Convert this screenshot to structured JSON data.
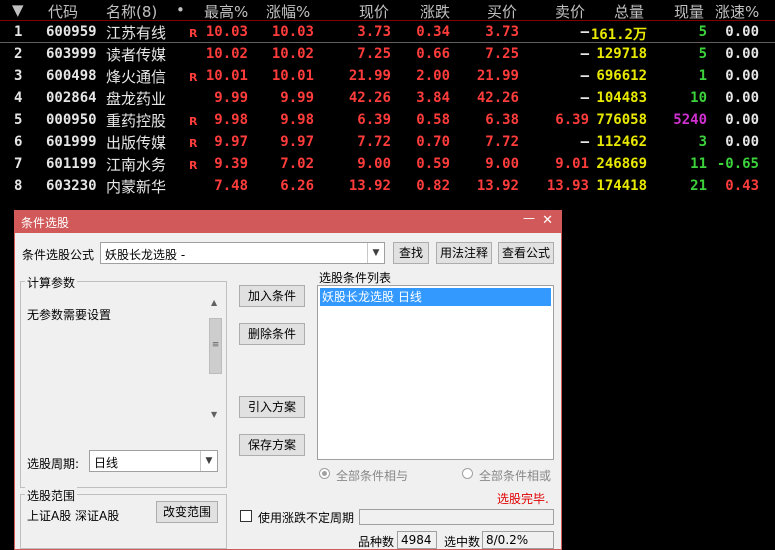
{
  "table": {
    "sort_icon": "sort-down-icon",
    "headers": [
      "代码",
      "名称(8)",
      "•",
      "最高%",
      "涨幅%",
      "现价",
      "涨跌",
      "买价",
      "卖价",
      "总量",
      "现量",
      "涨速%"
    ],
    "rows": [
      {
        "idx": "1",
        "code": "600959",
        "name": "江苏有线",
        "mark": "R",
        "high": "10.03",
        "chg_pct": "10.03",
        "price": "3.73",
        "change": "0.34",
        "bid": "3.73",
        "ask": "—",
        "volume": "161.2万",
        "cur_vol": "5",
        "speed": "0.00"
      },
      {
        "idx": "2",
        "code": "603999",
        "name": "读者传媒",
        "mark": "",
        "high": "10.02",
        "chg_pct": "10.02",
        "price": "7.25",
        "change": "0.66",
        "bid": "7.25",
        "ask": "—",
        "volume": "129718",
        "cur_vol": "5",
        "speed": "0.00"
      },
      {
        "idx": "3",
        "code": "600498",
        "name": "烽火通信",
        "mark": "R",
        "high": "10.01",
        "chg_pct": "10.01",
        "price": "21.99",
        "change": "2.00",
        "bid": "21.99",
        "ask": "—",
        "volume": "696612",
        "cur_vol": "1",
        "speed": "0.00"
      },
      {
        "idx": "4",
        "code": "002864",
        "name": "盘龙药业",
        "mark": "",
        "high": "9.99",
        "chg_pct": "9.99",
        "price": "42.26",
        "change": "3.84",
        "bid": "42.26",
        "ask": "—",
        "volume": "104483",
        "cur_vol": "10",
        "speed": "0.00"
      },
      {
        "idx": "5",
        "code": "000950",
        "name": "重药控股",
        "mark": "R",
        "high": "9.98",
        "chg_pct": "9.98",
        "price": "6.39",
        "change": "0.58",
        "bid": "6.38",
        "ask": "6.39",
        "volume": "776058",
        "cur_vol": "5240",
        "speed": "0.00"
      },
      {
        "idx": "6",
        "code": "601999",
        "name": "出版传媒",
        "mark": "R",
        "high": "9.97",
        "chg_pct": "9.97",
        "price": "7.72",
        "change": "0.70",
        "bid": "7.72",
        "ask": "—",
        "volume": "112462",
        "cur_vol": "3",
        "speed": "0.00"
      },
      {
        "idx": "7",
        "code": "601199",
        "name": "江南水务",
        "mark": "R",
        "high": "9.39",
        "chg_pct": "7.02",
        "price": "9.00",
        "change": "0.59",
        "bid": "9.00",
        "ask": "9.01",
        "volume": "246869",
        "cur_vol": "11",
        "speed": "-0.65"
      },
      {
        "idx": "8",
        "code": "603230",
        "name": "内蒙新华",
        "mark": "",
        "high": "7.48",
        "chg_pct": "6.26",
        "price": "13.92",
        "change": "0.82",
        "bid": "13.92",
        "ask": "13.93",
        "volume": "174418",
        "cur_vol": "21",
        "speed": "0.43"
      }
    ]
  },
  "dialog": {
    "title": "条件选股",
    "minimize_glyph": "—",
    "close_glyph": "✕",
    "formula_label": "条件选股公式",
    "formula_value": "妖股长龙选股 -",
    "dropdown_glyph": "▼",
    "btn_find": "查找",
    "btn_usage": "用法注释",
    "btn_view": "查看公式",
    "params_group": "计算参数",
    "params_text": "无参数需要设置",
    "scroll_up": "▲",
    "scroll_down": "▼",
    "scroll_grip": "≡",
    "period_label": "选股周期:",
    "period_value": "日线",
    "btn_add": "加入条件",
    "btn_delete": "删除条件",
    "btn_import": "引入方案",
    "btn_save": "保存方案",
    "list_title": "选股条件列表",
    "list_items": [
      "妖股长龙选股  日线"
    ],
    "radio_and": "全部条件相与",
    "radio_or": "全部条件相或",
    "status": "选股完毕.",
    "range_group": "选股范围",
    "range_value": "上证A股 深证A股",
    "btn_change_range": "改变范围",
    "chk_label": "使用涨跌不定周期",
    "count_label": "品种数",
    "count_value": "4984",
    "selected_label": "选中数",
    "selected_value": "8/0.2%"
  }
}
